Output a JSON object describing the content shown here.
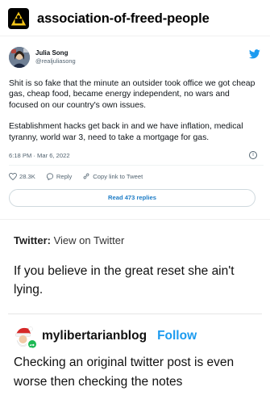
{
  "post": {
    "blog_name": "association-of-freed-people"
  },
  "tweet": {
    "author_name": "Julia Song",
    "author_handle": "@realjuliasong",
    "paragraphs": [
      "Shit is so fake that the minute an outsider took office we got cheap gas, cheap food, became energy independent, no wars and focused on our country's own issues.",
      "Establishment hacks get back in and we have inflation, medical tyranny, world war 3, need to take a mortgage for gas."
    ],
    "timestamp": "6:18 PM · Mar 6, 2022",
    "likes": "28.3K",
    "reply_label": "Reply",
    "copy_label": "Copy link to Tweet",
    "read_replies": "Read 473 replies",
    "brand_color": "#1d9bf0"
  },
  "source": {
    "platform": "Twitter:",
    "link_text": "View on Twitter"
  },
  "caption": "If you believe in the great reset she ain't lying.",
  "reblog": {
    "blog_name": "mylibertarianblog",
    "follow_label": "Follow",
    "text": "Checking an original twitter post is even worse then checking the notes"
  }
}
